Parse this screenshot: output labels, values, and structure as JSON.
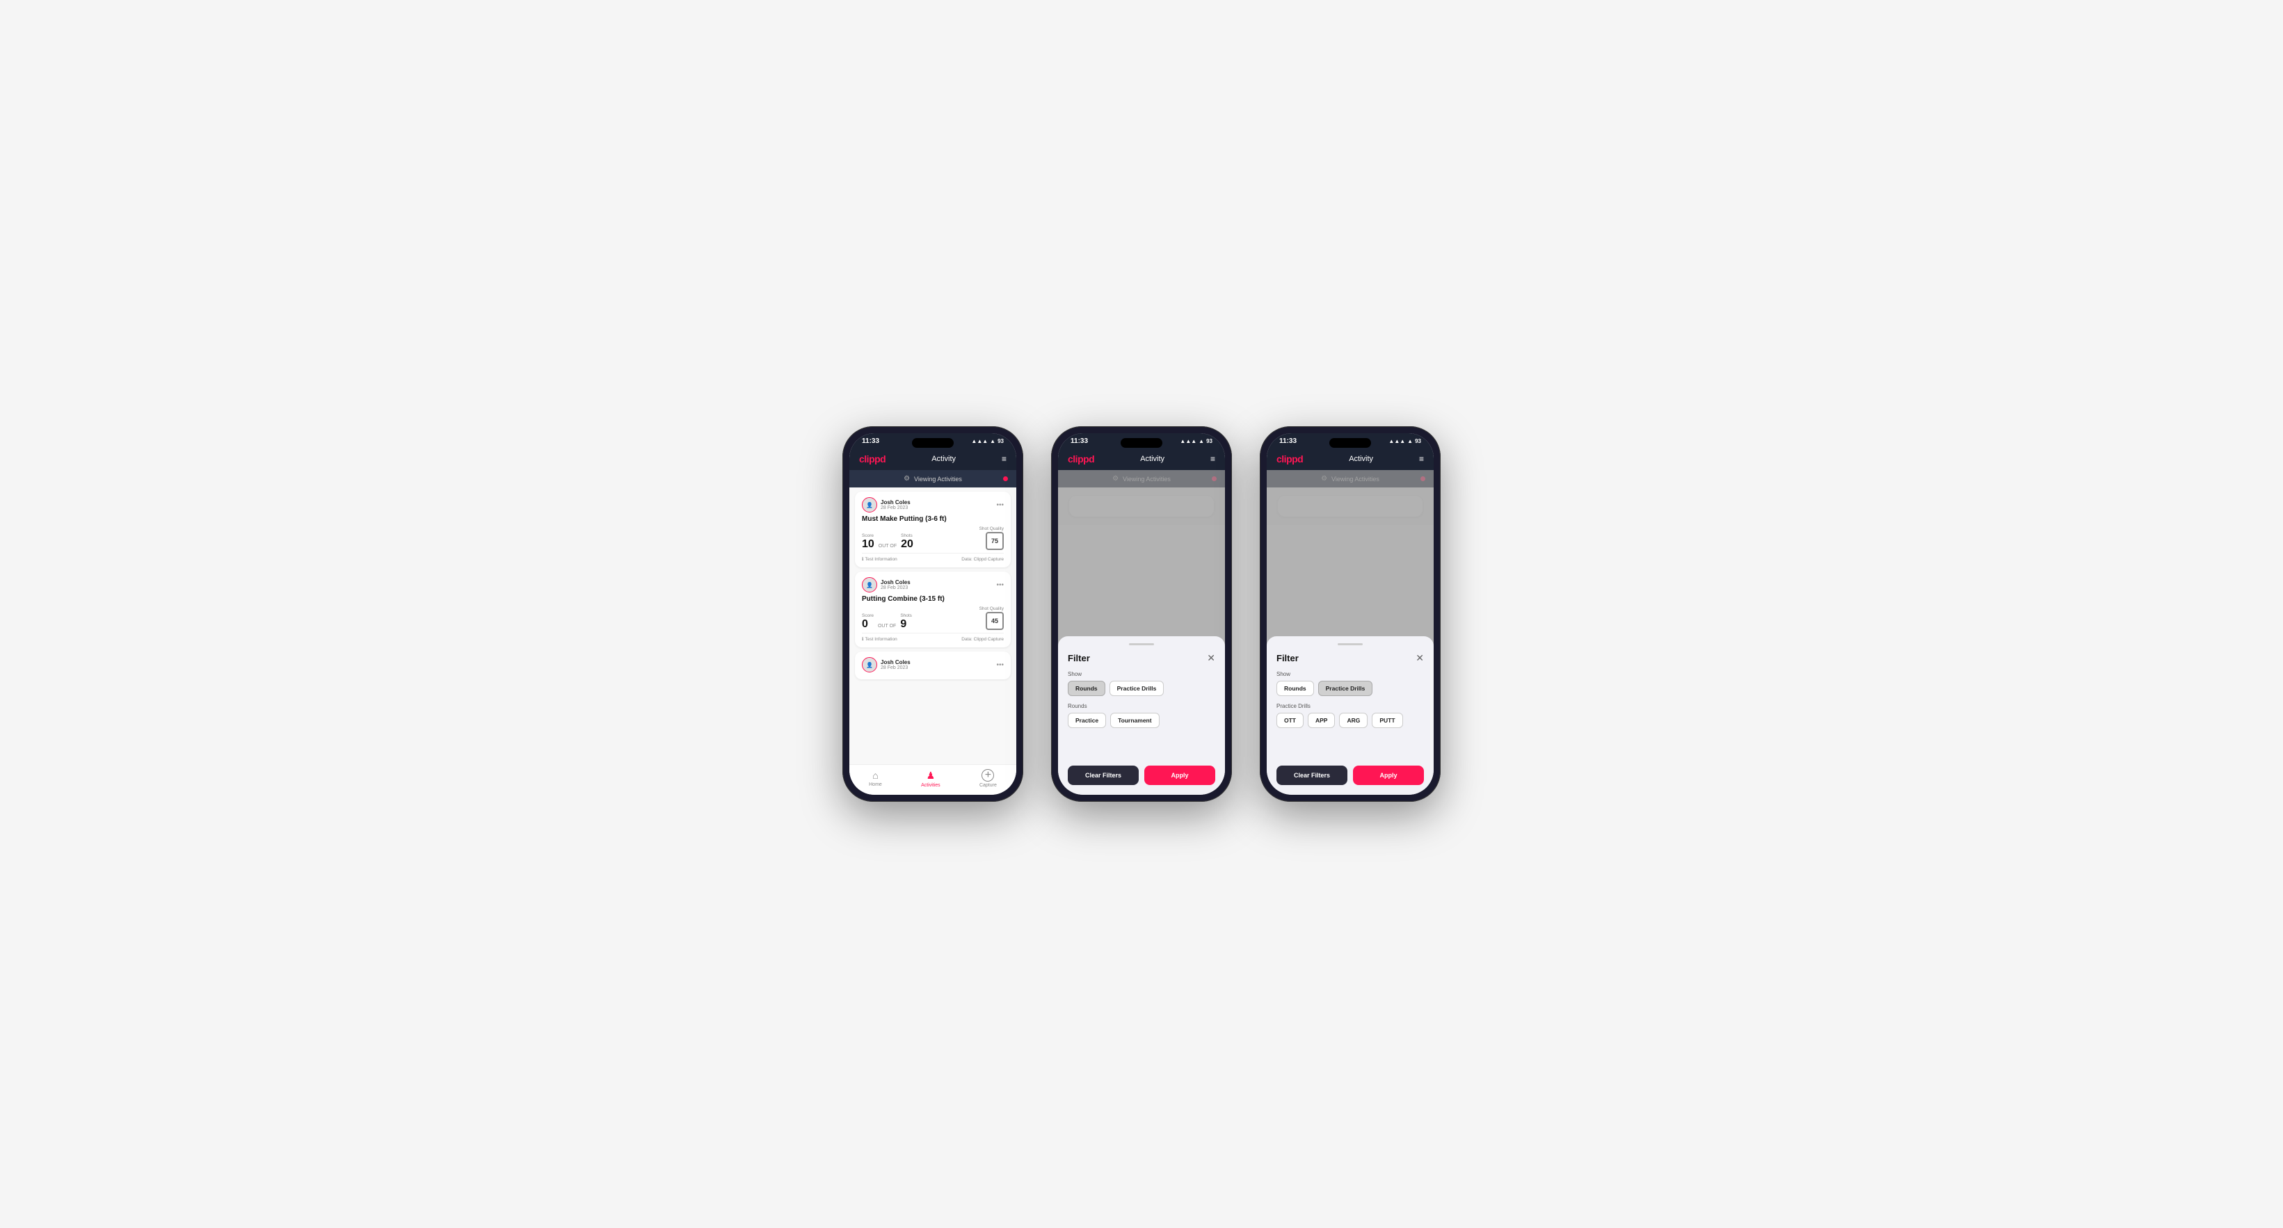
{
  "phones": [
    {
      "id": "phone1",
      "type": "activity-list",
      "status": {
        "time": "11:33",
        "signal": "●●●",
        "wifi": "wifi",
        "battery": "93"
      },
      "header": {
        "logo": "clippd",
        "title": "Activity",
        "menu_icon": "≡"
      },
      "viewing_bar": {
        "icon": "⚙",
        "text": "Viewing Activities"
      },
      "cards": [
        {
          "user_name": "Josh Coles",
          "user_date": "28 Feb 2023",
          "title": "Must Make Putting (3-6 ft)",
          "score_label": "Score",
          "score": "10",
          "out_of_label": "OUT OF",
          "shots_label": "Shots",
          "shots": "20",
          "shot_quality_label": "Shot Quality",
          "shot_quality": "75",
          "footer_info": "Test Information",
          "footer_data": "Data: Clippd Capture"
        },
        {
          "user_name": "Josh Coles",
          "user_date": "28 Feb 2023",
          "title": "Putting Combine (3-15 ft)",
          "score_label": "Score",
          "score": "0",
          "out_of_label": "OUT OF",
          "shots_label": "Shots",
          "shots": "9",
          "shot_quality_label": "Shot Quality",
          "shot_quality": "45",
          "footer_info": "Test Information",
          "footer_data": "Data: Clippd Capture"
        },
        {
          "user_name": "Josh Coles",
          "user_date": "28 Feb 2023",
          "title": "",
          "score_label": "",
          "score": "",
          "out_of_label": "",
          "shots_label": "",
          "shots": "",
          "shot_quality_label": "",
          "shot_quality": "",
          "footer_info": "",
          "footer_data": ""
        }
      ],
      "nav": {
        "items": [
          {
            "icon": "⌂",
            "label": "Home",
            "active": false
          },
          {
            "icon": "♟",
            "label": "Activities",
            "active": true
          },
          {
            "icon": "+",
            "label": "Capture",
            "active": false
          }
        ]
      }
    },
    {
      "id": "phone2",
      "type": "filter-rounds",
      "status": {
        "time": "11:33",
        "signal": "●●●",
        "wifi": "wifi",
        "battery": "93"
      },
      "header": {
        "logo": "clippd",
        "title": "Activity",
        "menu_icon": "≡"
      },
      "viewing_bar": {
        "icon": "⚙",
        "text": "Viewing Activities"
      },
      "filter": {
        "title": "Filter",
        "show_label": "Show",
        "show_buttons": [
          {
            "label": "Rounds",
            "active": true
          },
          {
            "label": "Practice Drills",
            "active": false
          }
        ],
        "rounds_label": "Rounds",
        "rounds_buttons": [
          {
            "label": "Practice",
            "active": false
          },
          {
            "label": "Tournament",
            "active": false
          }
        ],
        "clear_label": "Clear Filters",
        "apply_label": "Apply"
      }
    },
    {
      "id": "phone3",
      "type": "filter-drills",
      "status": {
        "time": "11:33",
        "signal": "●●●",
        "wifi": "wifi",
        "battery": "93"
      },
      "header": {
        "logo": "clippd",
        "title": "Activity",
        "menu_icon": "≡"
      },
      "viewing_bar": {
        "icon": "⚙",
        "text": "Viewing Activities"
      },
      "filter": {
        "title": "Filter",
        "show_label": "Show",
        "show_buttons": [
          {
            "label": "Rounds",
            "active": false
          },
          {
            "label": "Practice Drills",
            "active": true
          }
        ],
        "drills_label": "Practice Drills",
        "drills_buttons": [
          {
            "label": "OTT",
            "active": false
          },
          {
            "label": "APP",
            "active": false
          },
          {
            "label": "ARG",
            "active": false
          },
          {
            "label": "PUTT",
            "active": false
          }
        ],
        "clear_label": "Clear Filters",
        "apply_label": "Apply"
      }
    }
  ]
}
